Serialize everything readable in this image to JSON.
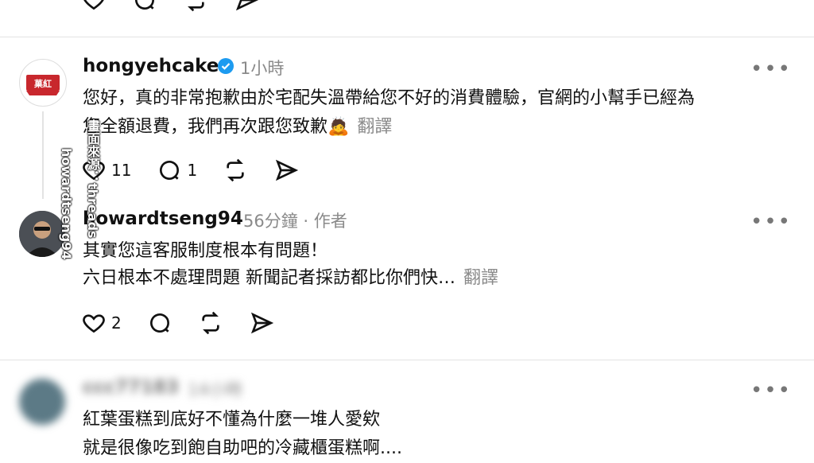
{
  "top_actions": {
    "icons": [
      "heart-icon",
      "comment-icon",
      "repost-icon",
      "share-icon"
    ]
  },
  "post1": {
    "username": "hongyehcake",
    "verified": true,
    "time": "1小時",
    "line1": "您好，真的非常抱歉由於宅配失溫帶給您不好的消費體驗，官網的小幫手已經為",
    "line2": "您全額退費，我們再次跟您致歉🙇",
    "translate": "翻譯",
    "likes": "11",
    "comments": "1",
    "more": "•••"
  },
  "post2": {
    "username": "howardtseng94",
    "time": "56分鐘 · 作者",
    "line1": "其實您這客服制度根本有問題！",
    "line2": "六日根本不處理問題 新聞記者採訪都比你們快…",
    "translate": "翻譯",
    "likes": "2",
    "more": "•••"
  },
  "post3": {
    "username": "ccc77183",
    "time": "14小時",
    "line1": "紅葉蛋糕到底好不懂為什麼一堆人愛欸",
    "line2": "就是很像吃到飽自助吧的冷藏櫃蛋糕啊....",
    "more": "•••"
  },
  "watermark": {
    "col1": "畫面來源：threads",
    "col2": "howardtseng94"
  },
  "colors": {
    "verified": "#1d9bf0",
    "logo_red": "#c8272d",
    "gray": "#8a8a8a"
  }
}
